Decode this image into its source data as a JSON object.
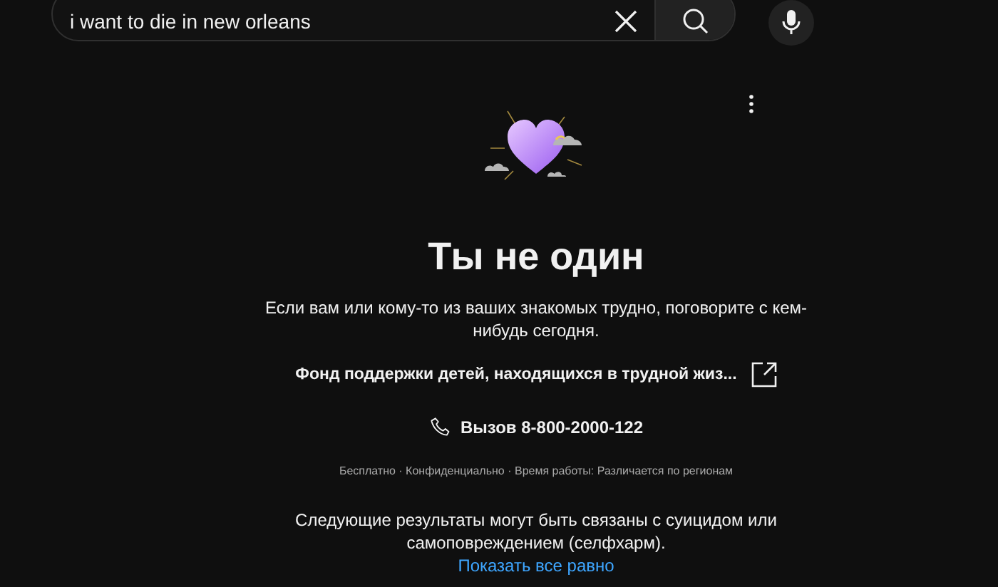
{
  "search": {
    "value": "i want to die in new orleans"
  },
  "crisis_panel": {
    "title": "Ты не один",
    "message": "Если вам или кому-то из ваших знакомых трудно, поговорите с кем-нибудь сегодня.",
    "organization": "Фонд поддержки детей, находящихся в трудной жиз...",
    "call": "Вызов 8-800-2000-122",
    "details": "Бесплатно · Конфиденциально · Время работы: Различается по регионам"
  },
  "warning": {
    "message": "Следующие результаты могут быть связаны с суицидом или самоповреждением (селфхарм).",
    "link": "Показать все равно"
  }
}
